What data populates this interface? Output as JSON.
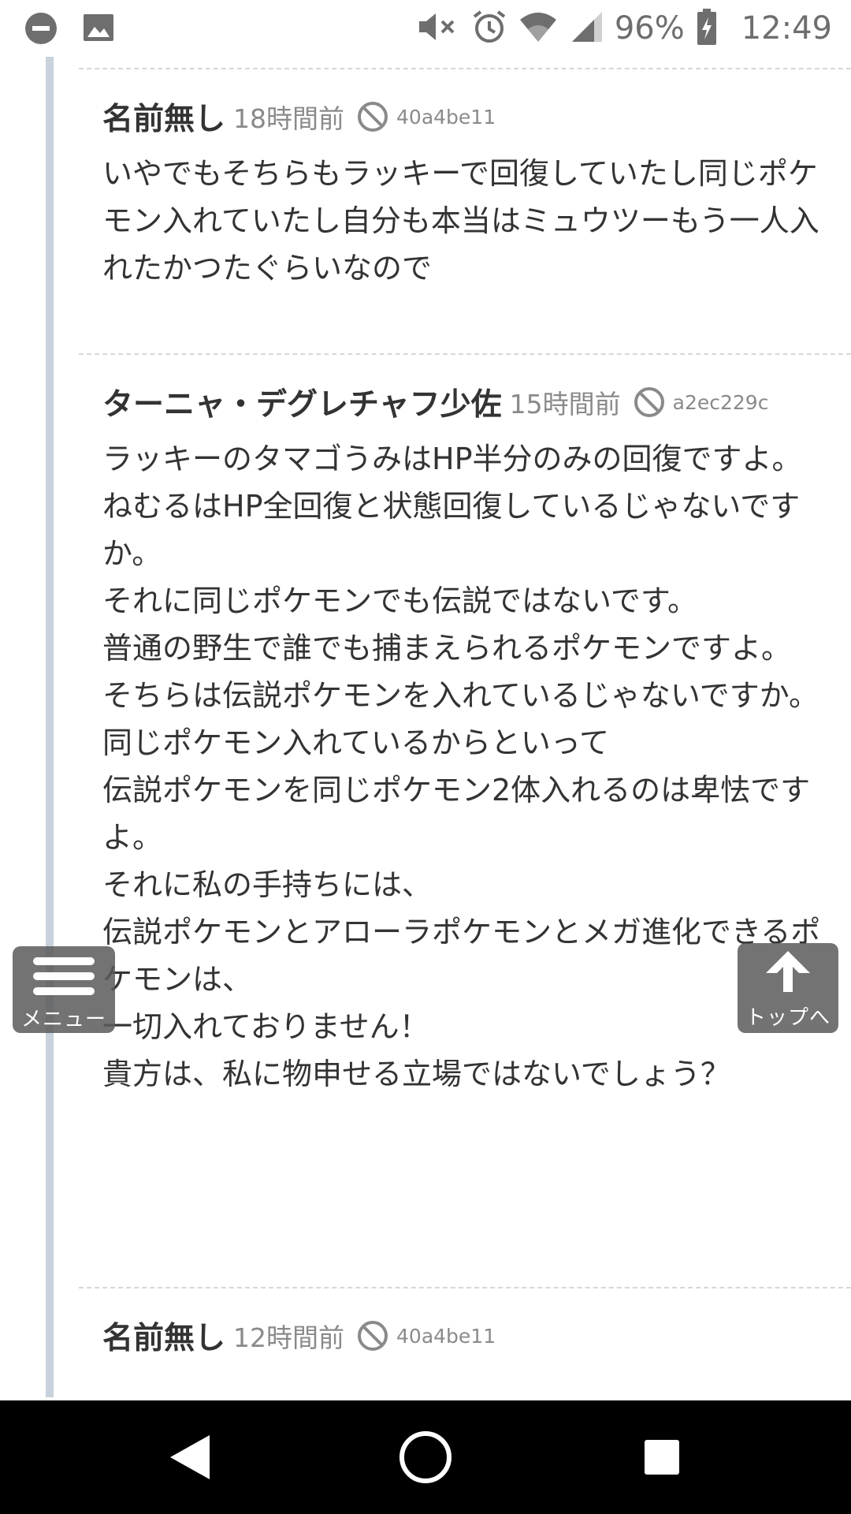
{
  "status_bar": {
    "left_icons": [
      "minus-circle-icon",
      "image-icon"
    ],
    "right_icons": [
      "mute-icon",
      "alarm-icon",
      "wifi-icon",
      "signal-icon",
      "battery-charging-icon"
    ],
    "battery": "96%",
    "time": "12:49"
  },
  "comments": [
    {
      "author": "名前無し",
      "time": "18時間前",
      "id": "40a4be11",
      "body": "いやでもそちらもラッキーで回復していたし同じポケモン入れていたし自分も本当はミュウツーもう一人入れたかつたぐらいなので"
    },
    {
      "author": "ターニャ・デグレチャフ少佐",
      "time": "15時間前",
      "id": "a2ec229c",
      "body": "ラッキーのタマゴうみはHP半分のみの回復ですよ。\nねむるはHP全回復と状態回復しているじゃないですか。\nそれに同じポケモンでも伝説ではないです。\n普通の野生で誰でも捕まえられるポケモンですよ。\nそちらは伝説ポケモンを入れているじゃないですか。\n同じポケモン入れているからといって\n伝説ポケモンを同じポケモン2体入れるのは卑怯ですよ。\nそれに私の手持ちには、\n伝説ポケモンとアローラポケモンとメガ進化できるポケモンは、\n一切入れておりません！\n貴方は、私に物申せる立場ではないでしょう？"
    },
    {
      "author": "名前無し",
      "time": "12時間前",
      "id": "40a4be11",
      "body": ""
    }
  ],
  "menu_button": {
    "label": "メニュー",
    "icon": "hamburger-icon"
  },
  "top_button": {
    "label": "トップへ",
    "icon": "arrow-up-icon"
  },
  "nav": {
    "icons": [
      "back-icon",
      "home-icon",
      "recents-icon"
    ]
  },
  "colors": {
    "thread_line": "#c8d2dc",
    "text": "#333333",
    "meta": "#8a8a8a",
    "float_button": "#5a5a5a"
  }
}
